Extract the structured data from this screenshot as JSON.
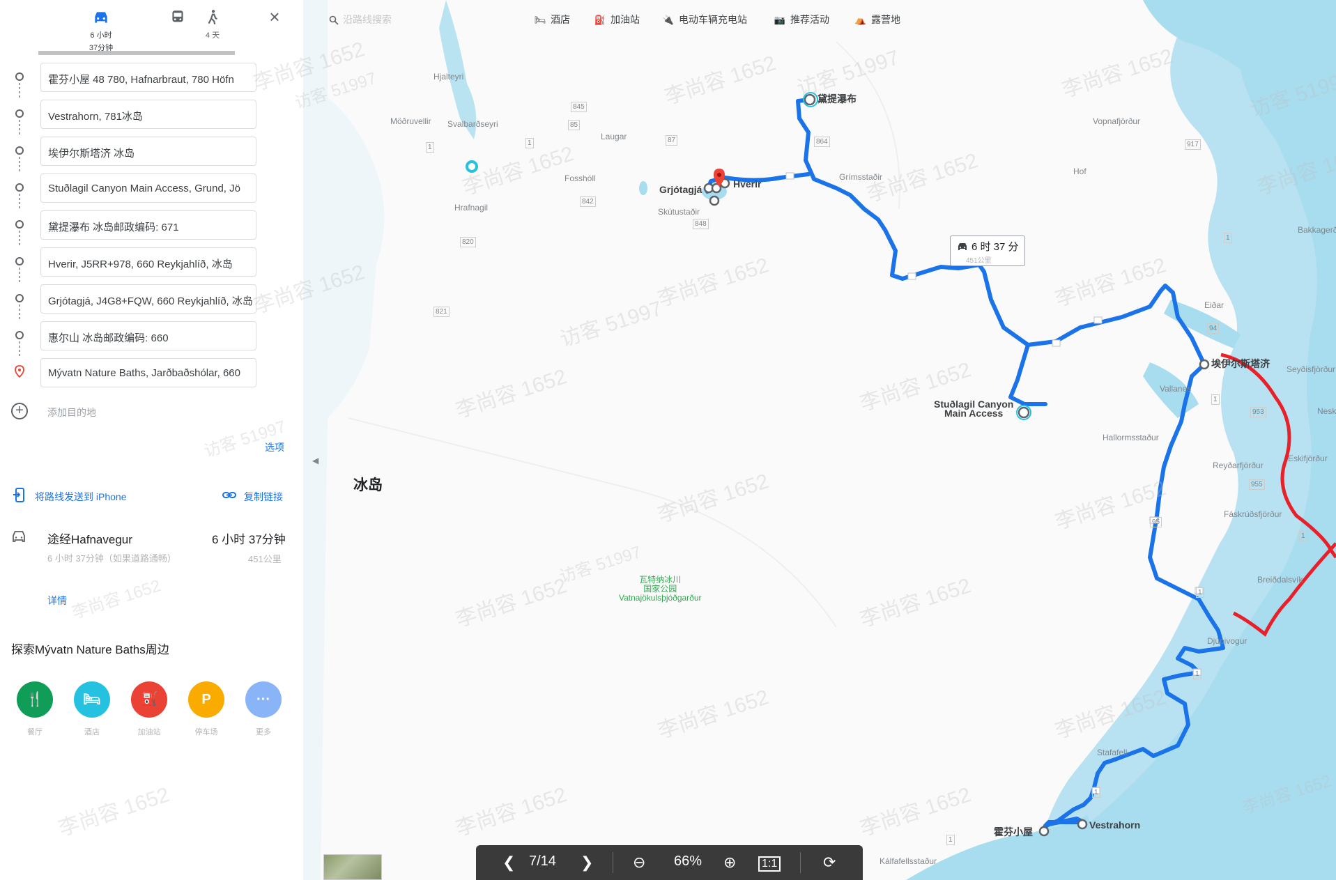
{
  "sidebar": {
    "modes": [
      {
        "name": "driving",
        "line1": "6 小时",
        "line2": "37分钟",
        "active": true
      },
      {
        "name": "transit",
        "line1": "",
        "line2": ""
      },
      {
        "name": "walking",
        "line1": "4 天",
        "line2": ""
      }
    ],
    "stops": [
      "霍芬小屋 48 780, Hafnarbraut, 780 Höfn",
      "Vestrahorn, 781冰岛",
      "埃伊尔斯塔济 冰岛",
      "Stuðlagil Canyon Main Access, Grund, Jö",
      "黛提瀑布 冰岛邮政编码: 671",
      "Hverir, J5RR+978, 660 Reykjahlíð, 冰岛",
      "Grjótagjá, J4G8+FQW, 660 Reykjahlíð, 冰岛",
      "惠尔山 冰岛邮政编码: 660",
      "Mývatn Nature Baths, Jarðbaðshólar, 660"
    ],
    "add_destination": "添加目的地",
    "options": "选项",
    "send_to_phone": "将路线发送到 iPhone",
    "copy_link": "复制链接",
    "route": {
      "via": "途经Hafnavegur",
      "duration": "6 小时 37分钟",
      "sub": "6 小时 37分钟（如果道路通畅）",
      "distance": "451公里",
      "details": "详情"
    },
    "explore_title": "探索Mývatn Nature Baths周边",
    "categories": [
      {
        "label": "餐厅",
        "icon": "restaurant-icon",
        "color": "#0f9d58"
      },
      {
        "label": "酒店",
        "icon": "hotel-icon",
        "color": "#24c1e0"
      },
      {
        "label": "加油站",
        "icon": "gas-station-icon",
        "color": "#ea4335"
      },
      {
        "label": "停车场",
        "icon": "parking-icon",
        "color": "#f9ab00"
      },
      {
        "label": "更多",
        "icon": "more-icon",
        "color": "#8ab4f8"
      }
    ]
  },
  "topbar": {
    "search_placeholder": "沿路线搜索",
    "chips": [
      "酒店",
      "加油站",
      "电动车辆充电站",
      "推荐活动",
      "露营地"
    ]
  },
  "map": {
    "country": "冰岛",
    "route_badge": {
      "time": "6 时 37 分",
      "dist": "451公里"
    },
    "places": {
      "dettifoss": "黛提瀑布",
      "hverir": "Hverir",
      "grjotagja": "Grjótagjá",
      "skutustadir": "Skútustaðir",
      "studlagil": "Stuðlagil Canyon\nMain Access",
      "egilsstadir": "埃伊尔斯塔济",
      "hofn": "霍芬小屋",
      "vestrahorn": "Vestrahorn",
      "vatnajokull": "瓦特纳冰川\n国家公园\nVatnajökulsþjóðgarður",
      "hjalteyri": "Hjalteyri",
      "svalbardseyri": "Svalbarðseyri",
      "modruvellir": "Möðruvellir",
      "laugar": "Laugar",
      "fosshol": "Fosshóll",
      "hrafnagil": "Hrafnagil",
      "grimsstadir": "Grímsstaðir",
      "vopnafjordur": "Vopnafjörður",
      "hof": "Hof",
      "bakkagerdi": "Bakkagerði",
      "seydisfjordur": "Seyðisfjörður",
      "eidar": "Eiðar",
      "vallanes": "Vallanes",
      "hallormsstadur": "Hallormsstaður",
      "reydarfjordur": "Reyðarfjörður",
      "eskifjordur": "Eskifjörður",
      "faskrudsfjordur": "Fáskrúðsfjörður",
      "breiddalsvik": "Breiðdalsvík",
      "djupivogur": "Djúpivogur",
      "stafafell": "Stafafell",
      "kalfafellsstadur": "Kálfafellsstaður",
      "neskaupstadur": "Nesk"
    },
    "road_numbers": [
      "845",
      "85",
      "87",
      "1",
      "864",
      "842",
      "848",
      "1",
      "820",
      "821",
      "917",
      "1",
      "94",
      "1",
      "953",
      "955",
      "95",
      "1",
      "1",
      "1",
      "1",
      "1"
    ],
    "colors": {
      "route": "#1a73e8",
      "alt_route": "#e8202a",
      "water": "#a8dcef",
      "land": "#f8f9fa"
    }
  },
  "watermarks": [
    "李尚容 1652",
    "访客 51997"
  ],
  "viewer": {
    "page": "7/14",
    "zoom": "66%"
  }
}
